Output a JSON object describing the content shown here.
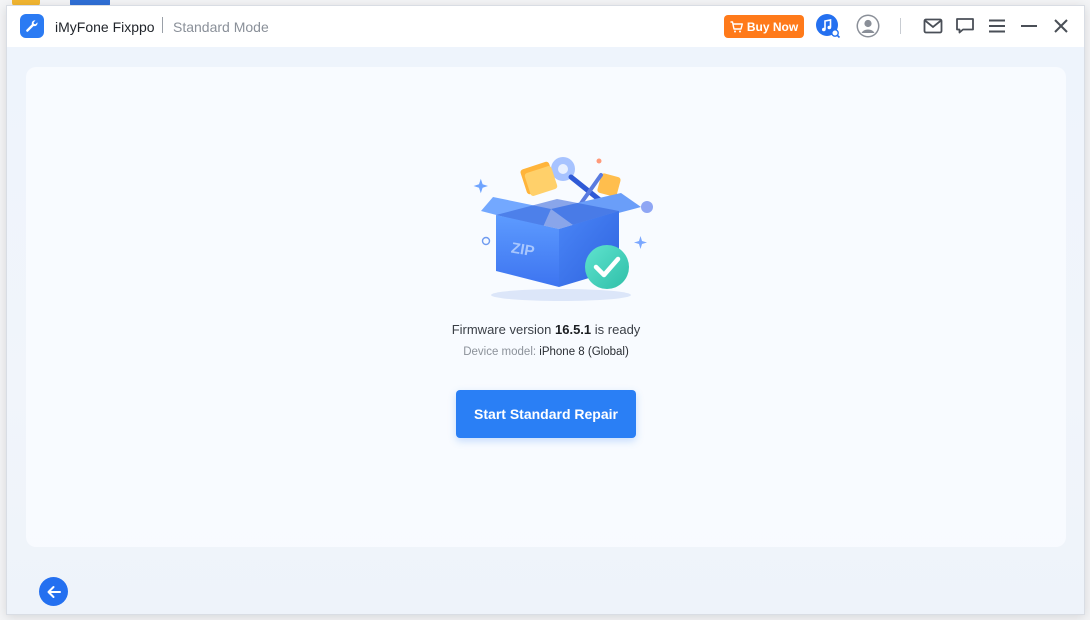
{
  "window": {
    "app_name": "iMyFone Fixppo",
    "mode": "Standard Mode"
  },
  "toolbar": {
    "buy_label": "Buy Now",
    "icons": [
      "cart-icon",
      "music-search-icon",
      "user-avatar-icon",
      "mail-icon",
      "feedback-icon",
      "menu-icon",
      "minimize-icon",
      "close-icon"
    ]
  },
  "main": {
    "firmware_prefix": "Firmware version",
    "firmware_version": "16.5.1",
    "firmware_suffix": "is ready",
    "device_label": "Device model:",
    "device_value": "iPhone 8 (Global)",
    "start_button": "Start Standard Repair",
    "zip_label": "ZIP"
  },
  "colors": {
    "accent": "#2a7ff5",
    "buy": "#ff7a1a",
    "success": "#3fd6c0"
  }
}
